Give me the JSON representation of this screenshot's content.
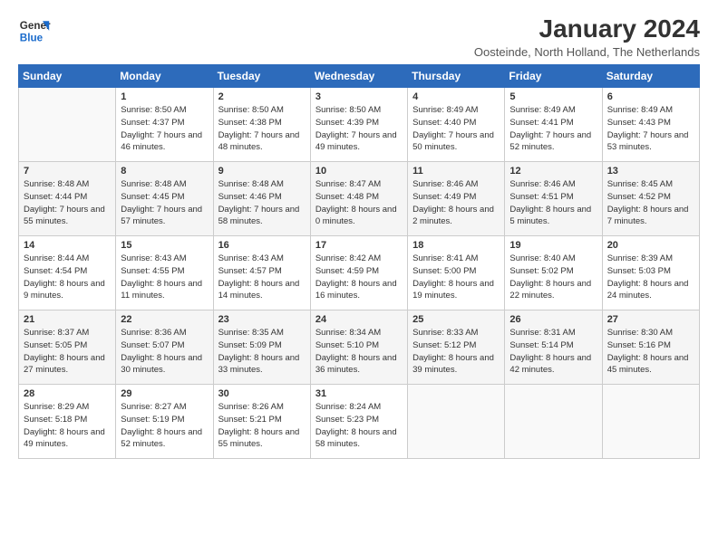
{
  "logo": {
    "line1": "General",
    "line2": "Blue"
  },
  "title": "January 2024",
  "subtitle": "Oosteinde, North Holland, The Netherlands",
  "weekdays": [
    "Sunday",
    "Monday",
    "Tuesday",
    "Wednesday",
    "Thursday",
    "Friday",
    "Saturday"
  ],
  "weeks": [
    [
      {
        "day": "",
        "sunrise": "",
        "sunset": "",
        "daylight": ""
      },
      {
        "day": "1",
        "sunrise": "Sunrise: 8:50 AM",
        "sunset": "Sunset: 4:37 PM",
        "daylight": "Daylight: 7 hours and 46 minutes."
      },
      {
        "day": "2",
        "sunrise": "Sunrise: 8:50 AM",
        "sunset": "Sunset: 4:38 PM",
        "daylight": "Daylight: 7 hours and 48 minutes."
      },
      {
        "day": "3",
        "sunrise": "Sunrise: 8:50 AM",
        "sunset": "Sunset: 4:39 PM",
        "daylight": "Daylight: 7 hours and 49 minutes."
      },
      {
        "day": "4",
        "sunrise": "Sunrise: 8:49 AM",
        "sunset": "Sunset: 4:40 PM",
        "daylight": "Daylight: 7 hours and 50 minutes."
      },
      {
        "day": "5",
        "sunrise": "Sunrise: 8:49 AM",
        "sunset": "Sunset: 4:41 PM",
        "daylight": "Daylight: 7 hours and 52 minutes."
      },
      {
        "day": "6",
        "sunrise": "Sunrise: 8:49 AM",
        "sunset": "Sunset: 4:43 PM",
        "daylight": "Daylight: 7 hours and 53 minutes."
      }
    ],
    [
      {
        "day": "7",
        "sunrise": "Sunrise: 8:48 AM",
        "sunset": "Sunset: 4:44 PM",
        "daylight": "Daylight: 7 hours and 55 minutes."
      },
      {
        "day": "8",
        "sunrise": "Sunrise: 8:48 AM",
        "sunset": "Sunset: 4:45 PM",
        "daylight": "Daylight: 7 hours and 57 minutes."
      },
      {
        "day": "9",
        "sunrise": "Sunrise: 8:48 AM",
        "sunset": "Sunset: 4:46 PM",
        "daylight": "Daylight: 7 hours and 58 minutes."
      },
      {
        "day": "10",
        "sunrise": "Sunrise: 8:47 AM",
        "sunset": "Sunset: 4:48 PM",
        "daylight": "Daylight: 8 hours and 0 minutes."
      },
      {
        "day": "11",
        "sunrise": "Sunrise: 8:46 AM",
        "sunset": "Sunset: 4:49 PM",
        "daylight": "Daylight: 8 hours and 2 minutes."
      },
      {
        "day": "12",
        "sunrise": "Sunrise: 8:46 AM",
        "sunset": "Sunset: 4:51 PM",
        "daylight": "Daylight: 8 hours and 5 minutes."
      },
      {
        "day": "13",
        "sunrise": "Sunrise: 8:45 AM",
        "sunset": "Sunset: 4:52 PM",
        "daylight": "Daylight: 8 hours and 7 minutes."
      }
    ],
    [
      {
        "day": "14",
        "sunrise": "Sunrise: 8:44 AM",
        "sunset": "Sunset: 4:54 PM",
        "daylight": "Daylight: 8 hours and 9 minutes."
      },
      {
        "day": "15",
        "sunrise": "Sunrise: 8:43 AM",
        "sunset": "Sunset: 4:55 PM",
        "daylight": "Daylight: 8 hours and 11 minutes."
      },
      {
        "day": "16",
        "sunrise": "Sunrise: 8:43 AM",
        "sunset": "Sunset: 4:57 PM",
        "daylight": "Daylight: 8 hours and 14 minutes."
      },
      {
        "day": "17",
        "sunrise": "Sunrise: 8:42 AM",
        "sunset": "Sunset: 4:59 PM",
        "daylight": "Daylight: 8 hours and 16 minutes."
      },
      {
        "day": "18",
        "sunrise": "Sunrise: 8:41 AM",
        "sunset": "Sunset: 5:00 PM",
        "daylight": "Daylight: 8 hours and 19 minutes."
      },
      {
        "day": "19",
        "sunrise": "Sunrise: 8:40 AM",
        "sunset": "Sunset: 5:02 PM",
        "daylight": "Daylight: 8 hours and 22 minutes."
      },
      {
        "day": "20",
        "sunrise": "Sunrise: 8:39 AM",
        "sunset": "Sunset: 5:03 PM",
        "daylight": "Daylight: 8 hours and 24 minutes."
      }
    ],
    [
      {
        "day": "21",
        "sunrise": "Sunrise: 8:37 AM",
        "sunset": "Sunset: 5:05 PM",
        "daylight": "Daylight: 8 hours and 27 minutes."
      },
      {
        "day": "22",
        "sunrise": "Sunrise: 8:36 AM",
        "sunset": "Sunset: 5:07 PM",
        "daylight": "Daylight: 8 hours and 30 minutes."
      },
      {
        "day": "23",
        "sunrise": "Sunrise: 8:35 AM",
        "sunset": "Sunset: 5:09 PM",
        "daylight": "Daylight: 8 hours and 33 minutes."
      },
      {
        "day": "24",
        "sunrise": "Sunrise: 8:34 AM",
        "sunset": "Sunset: 5:10 PM",
        "daylight": "Daylight: 8 hours and 36 minutes."
      },
      {
        "day": "25",
        "sunrise": "Sunrise: 8:33 AM",
        "sunset": "Sunset: 5:12 PM",
        "daylight": "Daylight: 8 hours and 39 minutes."
      },
      {
        "day": "26",
        "sunrise": "Sunrise: 8:31 AM",
        "sunset": "Sunset: 5:14 PM",
        "daylight": "Daylight: 8 hours and 42 minutes."
      },
      {
        "day": "27",
        "sunrise": "Sunrise: 8:30 AM",
        "sunset": "Sunset: 5:16 PM",
        "daylight": "Daylight: 8 hours and 45 minutes."
      }
    ],
    [
      {
        "day": "28",
        "sunrise": "Sunrise: 8:29 AM",
        "sunset": "Sunset: 5:18 PM",
        "daylight": "Daylight: 8 hours and 49 minutes."
      },
      {
        "day": "29",
        "sunrise": "Sunrise: 8:27 AM",
        "sunset": "Sunset: 5:19 PM",
        "daylight": "Daylight: 8 hours and 52 minutes."
      },
      {
        "day": "30",
        "sunrise": "Sunrise: 8:26 AM",
        "sunset": "Sunset: 5:21 PM",
        "daylight": "Daylight: 8 hours and 55 minutes."
      },
      {
        "day": "31",
        "sunrise": "Sunrise: 8:24 AM",
        "sunset": "Sunset: 5:23 PM",
        "daylight": "Daylight: 8 hours and 58 minutes."
      },
      {
        "day": "",
        "sunrise": "",
        "sunset": "",
        "daylight": ""
      },
      {
        "day": "",
        "sunrise": "",
        "sunset": "",
        "daylight": ""
      },
      {
        "day": "",
        "sunrise": "",
        "sunset": "",
        "daylight": ""
      }
    ]
  ]
}
